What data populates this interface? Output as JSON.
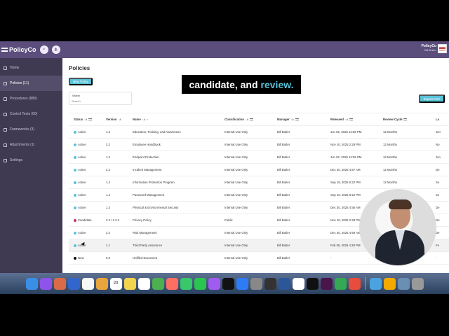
{
  "app": {
    "name": "PolicyCo",
    "user_org": "PolicyCo",
    "user_name": "Bill Butler"
  },
  "sidebar": {
    "items": [
      {
        "label": "Home",
        "icon": "home-icon"
      },
      {
        "label": "Policies (11)",
        "icon": "document-icon"
      },
      {
        "label": "Procedures (888)",
        "icon": "procedure-icon"
      },
      {
        "label": "Control Tests (60)",
        "icon": "test-icon"
      },
      {
        "label": "Frameworks (3)",
        "icon": "framework-icon"
      },
      {
        "label": "Attachments (1)",
        "icon": "attachment-icon"
      },
      {
        "label": "Settings",
        "icon": "gear-icon"
      }
    ]
  },
  "main": {
    "title": "Policies",
    "new_button": "New Policy",
    "search_label": "Search",
    "search_placeholder": "Search",
    "export_button": "Export CSV"
  },
  "overlay": {
    "text_main": "candidate, and",
    "text_accent": "review."
  },
  "table": {
    "columns": [
      "Status",
      "Version",
      "Name",
      "Classification",
      "Manager",
      "Released",
      "Review Cycle",
      "La"
    ],
    "rows": [
      {
        "status": "Active",
        "status_color": "#59c3d9",
        "version": "1.2",
        "name": "Education, Training, and Awareness",
        "classification": "Internal Use Only",
        "manager": "Bill Butler",
        "released": "Jun 02, 2025 12:55 PM",
        "cycle": "12 Months",
        "extra": "Jun"
      },
      {
        "status": "Active",
        "status_color": "#59c3d9",
        "version": "2.2",
        "name": "Employee Handbook",
        "classification": "Internal Use Only",
        "manager": "Bill Butler",
        "released": "Nov 10, 2025 2:28 PM",
        "cycle": "12 Months",
        "extra": "No"
      },
      {
        "status": "Active",
        "status_color": "#59c3d9",
        "version": "1.2",
        "name": "Endpoint Protection",
        "classification": "Internal Use Only",
        "manager": "Bill Butler",
        "released": "Jun 02, 2025 12:55 PM",
        "cycle": "12 Months",
        "extra": "Jun"
      },
      {
        "status": "Active",
        "status_color": "#59c3d9",
        "version": "2.4",
        "name": "Incident Management",
        "classification": "Internal Use Only",
        "manager": "Bill Butler",
        "released": "Dec 30, 2025 4:57 AM",
        "cycle": "12 Months",
        "extra": "De"
      },
      {
        "status": "Active",
        "status_color": "#59c3d9",
        "version": "1.4",
        "name": "Information Protection Program",
        "classification": "Internal Use Only",
        "manager": "Bill Butler",
        "released": "Sep 19, 2025 6:22 PM",
        "cycle": "12 Months",
        "extra": "Se"
      },
      {
        "status": "Active",
        "status_color": "#59c3d9",
        "version": "1.4",
        "name": "Password Management",
        "classification": "Internal Use Only",
        "manager": "Bill Butler",
        "released": "Sep 19, 2025 6:22 PM",
        "cycle": "12 Months",
        "extra": "Se"
      },
      {
        "status": "Active",
        "status_color": "#59c3d9",
        "version": "1.3",
        "name": "Physical & Environmental Security",
        "classification": "Internal Use Only",
        "manager": "Bill Butler",
        "released": "Dec 30, 2025 4:56 AM",
        "cycle": "12 Months",
        "extra": "De"
      },
      {
        "status": "Candidate",
        "status_color": "#c9365a",
        "version": "2.2 / 2.2.2",
        "name": "Privacy Policy",
        "classification": "Public",
        "manager": "Bill Butler",
        "released": "Nov 10, 2025 2:28 PM",
        "cycle": "12 Months",
        "extra": "No"
      },
      {
        "status": "Active",
        "status_color": "#59c3d9",
        "version": "2.4",
        "name": "Risk Management",
        "classification": "Internal Use Only",
        "manager": "Bill Butler",
        "released": "Dec 30, 2025 4:59 AM",
        "cycle": "12 Months",
        "extra": "De"
      },
      {
        "status": "Active",
        "status_color": "#59c3d9",
        "version": "1.1",
        "name": "Third Party Assurance",
        "classification": "Internal Use Only",
        "manager": "Bill Butler",
        "released": "Feb 05, 2025 4:28 PM",
        "cycle": "12 Months",
        "extra": "Fe"
      },
      {
        "status": "New",
        "status_color": "#111111",
        "version": "0.0",
        "name": "Unfilled Document",
        "classification": "Internal Use Only",
        "manager": "Bill Butler",
        "released": "-",
        "cycle": "12 Months",
        "extra": "-"
      }
    ]
  },
  "dock": {
    "icons": [
      "finder-icon",
      "siri-icon",
      "launchpad-icon",
      "safari-icon",
      "mail-icon",
      "contacts-icon",
      "calendar-icon",
      "notes-icon",
      "reminders-icon",
      "maps-icon",
      "photos-icon",
      "messages-icon",
      "facetime-icon",
      "podcasts-icon",
      "apple-tv-icon",
      "app-store-icon",
      "system-settings-icon",
      "chatgpt-icon",
      "word-icon",
      "chrome-icon",
      "capcut-icon",
      "slack-icon",
      "drive-icon",
      "spark-icon",
      "folder-icon",
      "pen-icon",
      "archive-icon",
      "trash-icon"
    ],
    "calendar_day": "20"
  }
}
